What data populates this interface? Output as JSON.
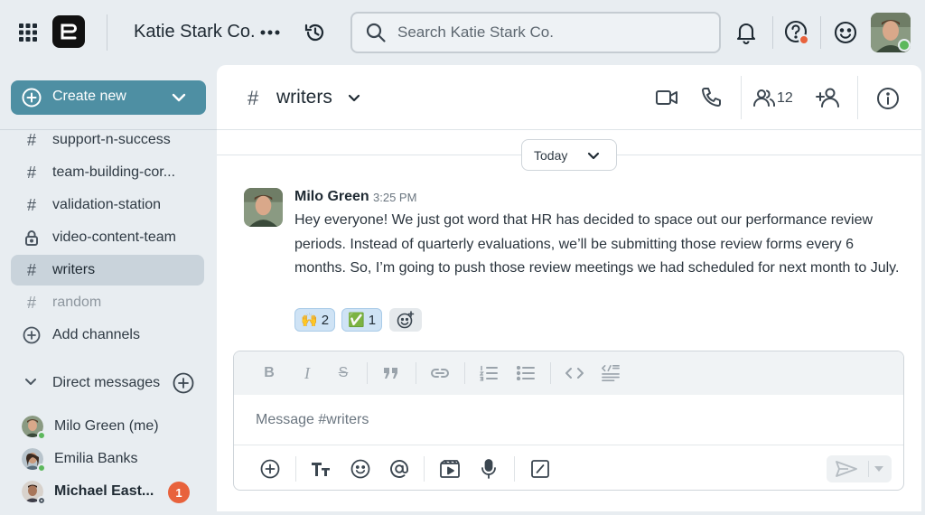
{
  "workspace": {
    "name": "Katie Stark Co."
  },
  "search": {
    "placeholder": "Search Katie Stark Co."
  },
  "sidebar": {
    "create_label": "Create new",
    "channels": [
      {
        "name": "support-n-success",
        "icon": "hash-icon"
      },
      {
        "name": "team-building-cor...",
        "icon": "hash-icon"
      },
      {
        "name": "validation-station",
        "icon": "hash-icon"
      },
      {
        "name": "video-content-team",
        "icon": "lock-icon"
      },
      {
        "name": "writers",
        "icon": "hash-icon",
        "active": true
      },
      {
        "name": "random",
        "icon": "hash-icon",
        "muted": true
      }
    ],
    "add_channels_label": "Add channels",
    "dm_header": "Direct messages",
    "dms": [
      {
        "name": "Milo Green (me)",
        "status": "online"
      },
      {
        "name": "Emilia Banks",
        "status": "online"
      },
      {
        "name": "Michael East...",
        "status": "offline",
        "unread": "1"
      }
    ]
  },
  "channel": {
    "name": "writers",
    "member_count": "12"
  },
  "date_divider": "Today",
  "message": {
    "author": "Milo Green",
    "time": "3:25 PM",
    "text": "Hey everyone! We just got word that HR has decided to space out our performance review periods. Instead of quarterly evaluations, we’ll be submitting those review forms every 6 months. So, I’m going to push those review meetings we had scheduled for next month to July.",
    "reactions": [
      {
        "emoji": "🙌",
        "count": "2"
      },
      {
        "emoji": "✅",
        "count": "1"
      }
    ]
  },
  "composer": {
    "placeholder": "Message #writers"
  },
  "colors": {
    "accent": "#4e8fa3",
    "active_channel_bg": "#c9d3db",
    "badge": "#e8623c",
    "online": "#5cb85c",
    "reaction_bg": "#cfe3f5"
  }
}
